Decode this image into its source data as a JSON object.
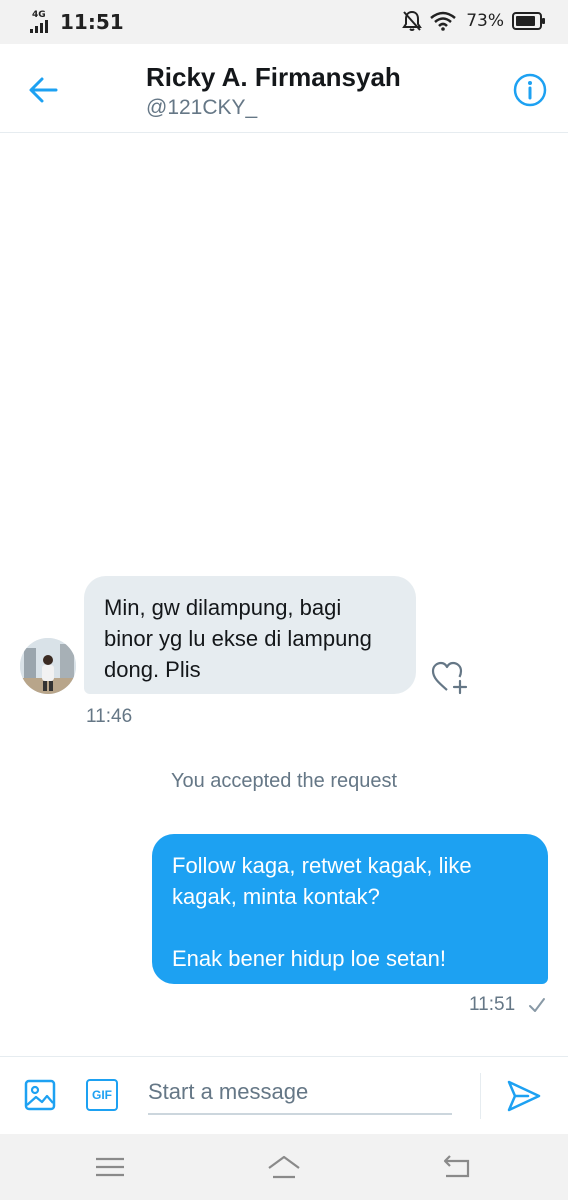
{
  "status_bar": {
    "network": "4G",
    "time": "11:51",
    "battery_percent": "73%"
  },
  "header": {
    "title": "Ricky A. Firmansyah",
    "handle": "@121CKY_"
  },
  "conversation": {
    "incoming": {
      "text": "Min, gw dilampung, bagi binor yg lu ekse di lampung dong. Plis",
      "time": "11:46"
    },
    "system_message": "You accepted the request",
    "outgoing": {
      "lines": [
        "Follow kaga, retwet kagak, like kagak, minta kontak?",
        "Enak bener hidup loe setan!"
      ],
      "time": "11:51"
    }
  },
  "composer": {
    "gif_label": "GIF",
    "placeholder": "Start a message"
  },
  "icons": {
    "back": "arrow-left-icon",
    "info": "info-icon",
    "like": "heart-plus-icon",
    "photo": "image-icon",
    "send": "send-icon",
    "read": "check-icon"
  },
  "colors": {
    "accent": "#1da1f2",
    "incoming_bubble": "#e6ecf0",
    "secondary_text": "#657786"
  }
}
